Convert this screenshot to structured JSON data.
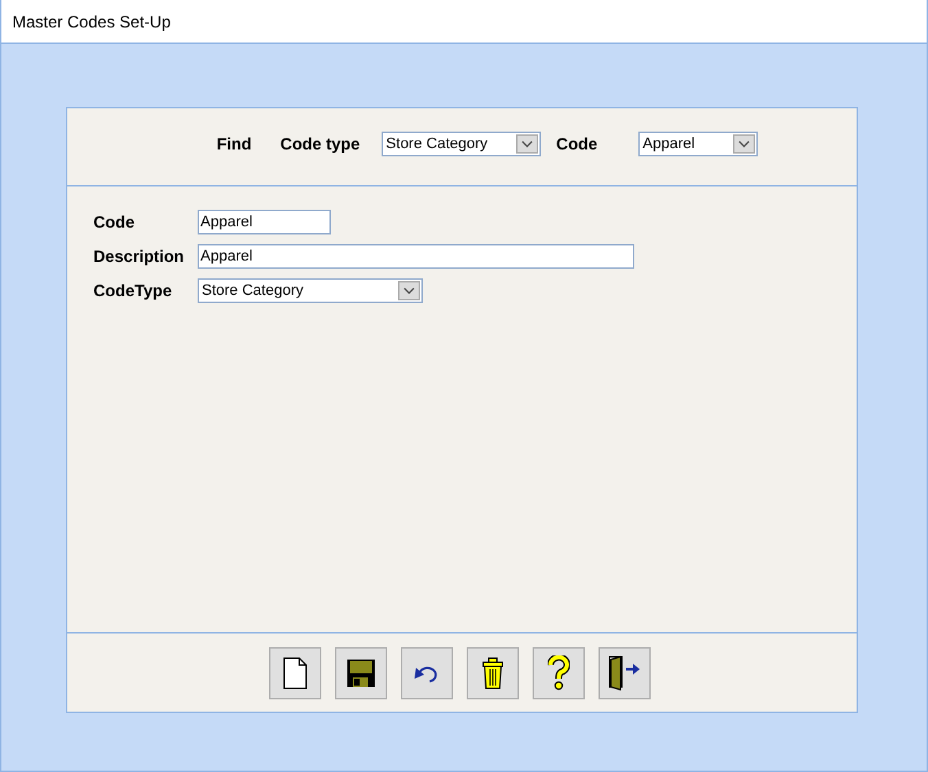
{
  "window": {
    "title": "Master Codes Set-Up"
  },
  "find": {
    "label": "Find",
    "code_type": {
      "label": "Code type",
      "value": "Store Category"
    },
    "code": {
      "label": "Code",
      "value": "Apparel"
    }
  },
  "form": {
    "fields": [
      {
        "kind": "text",
        "label": "Code",
        "value": "Apparel"
      },
      {
        "kind": "text",
        "label": "Description",
        "value": "Apparel"
      },
      {
        "kind": "select",
        "label": "CodeType",
        "value": "Store Category"
      }
    ]
  },
  "toolbar": [
    {
      "kind": "new"
    },
    {
      "kind": "save"
    },
    {
      "kind": "undo"
    },
    {
      "kind": "delete"
    },
    {
      "kind": "help"
    },
    {
      "kind": "exit"
    }
  ]
}
